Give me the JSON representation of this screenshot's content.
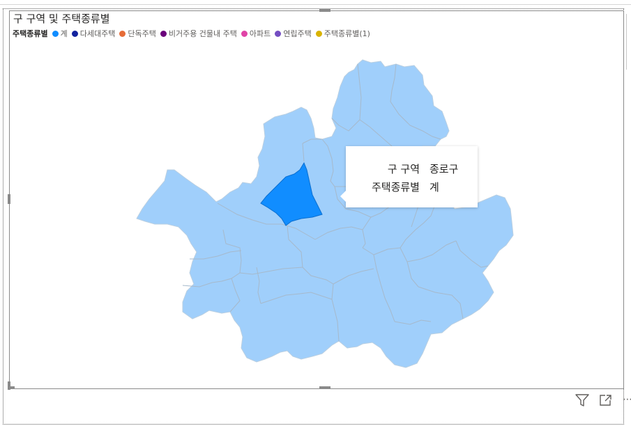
{
  "visual": {
    "title": "구 구역 및 주택종류별"
  },
  "legend": {
    "title": "주택종류별",
    "items": [
      {
        "label": "계",
        "color": "#118DFF"
      },
      {
        "label": "다세대주택",
        "color": "#12239E"
      },
      {
        "label": "단독주택",
        "color": "#E66C37"
      },
      {
        "label": "비거주용 건물내 주택",
        "color": "#6B007B"
      },
      {
        "label": "아파트",
        "color": "#E044A7"
      },
      {
        "label": "연립주택",
        "color": "#744EC2"
      },
      {
        "label": "주택종류별(1)",
        "color": "#D9B300"
      }
    ]
  },
  "map": {
    "region": "서울특별시",
    "fill_color": "#A0CFFB",
    "border_color": "#9fb7cc",
    "highlighted_district": "종로구",
    "highlight_color": "#118DFF"
  },
  "tooltip": {
    "rows": [
      {
        "key": "구 구역",
        "value": "종로구"
      },
      {
        "key": "주택종류별",
        "value": "계"
      }
    ]
  },
  "footer": {
    "filter_icon": "filter-icon",
    "focus_icon": "focus-mode-icon",
    "more_icon": "more-options-icon"
  }
}
